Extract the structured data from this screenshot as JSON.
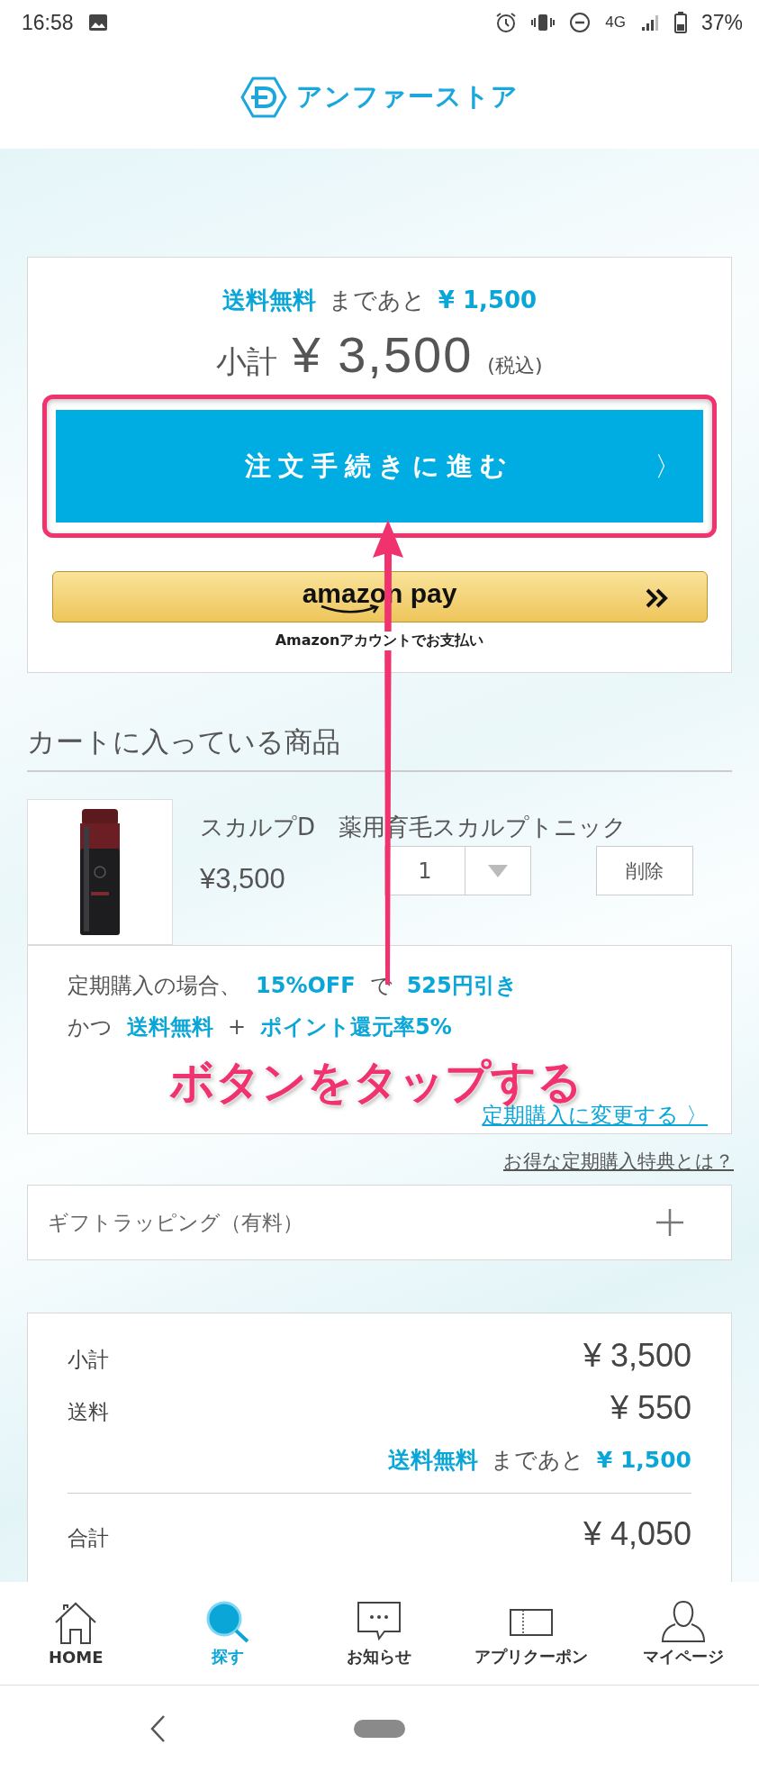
{
  "status_bar": {
    "time": "16:58",
    "network": "4G",
    "battery": "37%"
  },
  "header": {
    "logo_text": "アンファーストア"
  },
  "summary": {
    "free_shipping": [
      {
        "text": "送料無料",
        "highlight": true
      },
      {
        "text": "まであと",
        "highlight": false
      },
      {
        "text": "¥ 1,500",
        "highlight": true
      }
    ],
    "subtotal_label": "小計",
    "subtotal_amount": "¥ 3,500",
    "tax_note": "(税込)",
    "checkout_button": {
      "label": "注文手続きに進む",
      "chevron": "〉",
      "highlighted": true
    },
    "amazon_pay": {
      "label": "amazon pay",
      "caption": "Amazonアカウントでお支払い"
    }
  },
  "cart": {
    "heading": "カートに入っている商品",
    "items": [
      {
        "name": "スカルプD　薬用育毛スカルプトニック",
        "price": "¥3,500",
        "quantity": "1",
        "delete_label": "削除"
      }
    ]
  },
  "subscription_offer": {
    "lines": [
      [
        {
          "text": "定期購入の場合、",
          "highlight": false
        },
        {
          "text": "15%OFF",
          "highlight": true
        },
        {
          "text": "で",
          "highlight": false
        },
        {
          "text": "525円引き",
          "highlight": true
        }
      ],
      [
        {
          "text": "かつ",
          "highlight": false
        },
        {
          "text": "送料無料",
          "highlight": true
        },
        {
          "text": "+",
          "highlight": false
        },
        {
          "text": "ポイント還元率5%",
          "highlight": true
        }
      ]
    ],
    "link": "定期購入に変更する 〉"
  },
  "benefits_link": "お得な定期購入特典とは？",
  "gift_wrapping": {
    "label": "ギフトラッピング（有料）",
    "expanded": false
  },
  "totals": {
    "rows": [
      {
        "label": "小計",
        "amount": "¥ 3,500"
      },
      {
        "label": "送料",
        "amount": "¥ 550"
      }
    ],
    "free_shipping": [
      {
        "text": "送料無料",
        "highlight": true
      },
      {
        "text": "まであと",
        "highlight": false
      },
      {
        "text": "¥ 1,500",
        "highlight": true
      }
    ],
    "total": {
      "label": "合計",
      "amount": "¥ 4,050"
    }
  },
  "bottom_nav": [
    {
      "label": "HOME",
      "selected": false
    },
    {
      "label": "探す",
      "selected": true
    },
    {
      "label": "お知らせ",
      "selected": false
    },
    {
      "label": "アプリクーポン",
      "selected": false
    },
    {
      "label": "マイページ",
      "selected": false
    }
  ],
  "annotation": {
    "text": "ボタンをタップする"
  }
}
